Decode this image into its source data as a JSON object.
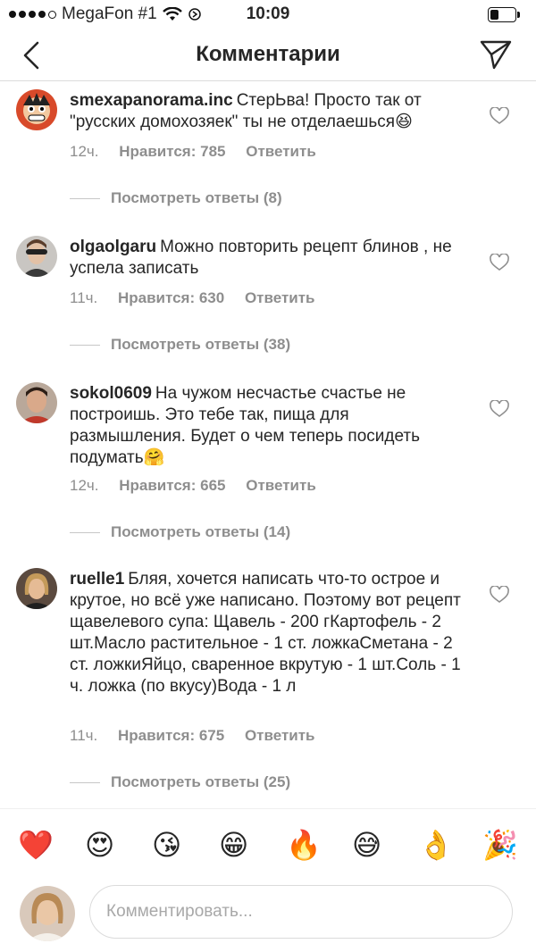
{
  "status_bar": {
    "carrier": "MegaFon #1",
    "time": "10:09",
    "signal_bars": 4,
    "signal_total": 5,
    "battery_level": 0.35
  },
  "nav": {
    "title": "Комментарии"
  },
  "comments": [
    {
      "username": "smexapanorama.inc",
      "text": "СтерЬва! Просто так от \"русских домохозяек\" ты не отделаешься😆",
      "time": "12ч.",
      "likes": "Нравится: 785",
      "reply": "Ответить",
      "view_replies": "Посмотреть ответы (8)"
    },
    {
      "username": "olgaolgaru",
      "text": "Можно повторить рецепт блинов , не успела записать",
      "time": "11ч.",
      "likes": "Нравится: 630",
      "reply": "Ответить",
      "view_replies": "Посмотреть ответы (38)"
    },
    {
      "username": "sokol0609",
      "text": "На чужом несчастье счастье не построишь.  Это тебе так, пища для размышления. Будет о чем теперь посидеть подумать🤗",
      "time": "12ч.",
      "likes": "Нравится: 665",
      "reply": "Ответить",
      "view_replies": "Посмотреть ответы (14)"
    },
    {
      "username": "ruelle1",
      "text": "Бляя, хочется написать что-то острое и крутое, но всё уже написано. Поэтому вот рецепт щавелевого супа: Щавель - 200 гКартофель - 2 шт.Масло растительное - 1 ст. ложкаСметана - 2 ст. ложкиЯйцо, сваренное вкрутую - 1 шт.Соль - 1 ч. ложка (по вкусу)Вода - 1 л",
      "time": "11ч.",
      "likes": "Нравится: 675",
      "reply": "Ответить",
      "view_replies": "Посмотреть ответы (25)"
    }
  ],
  "reactions": [
    "❤️",
    "😍",
    "😘",
    "😁",
    "🔥",
    "😅",
    "👌",
    "🎉"
  ],
  "composer": {
    "placeholder": "Комментировать..."
  },
  "colors": {
    "text": "#262626",
    "secondary": "#8e8e8e",
    "divider": "#dbdbdb"
  }
}
